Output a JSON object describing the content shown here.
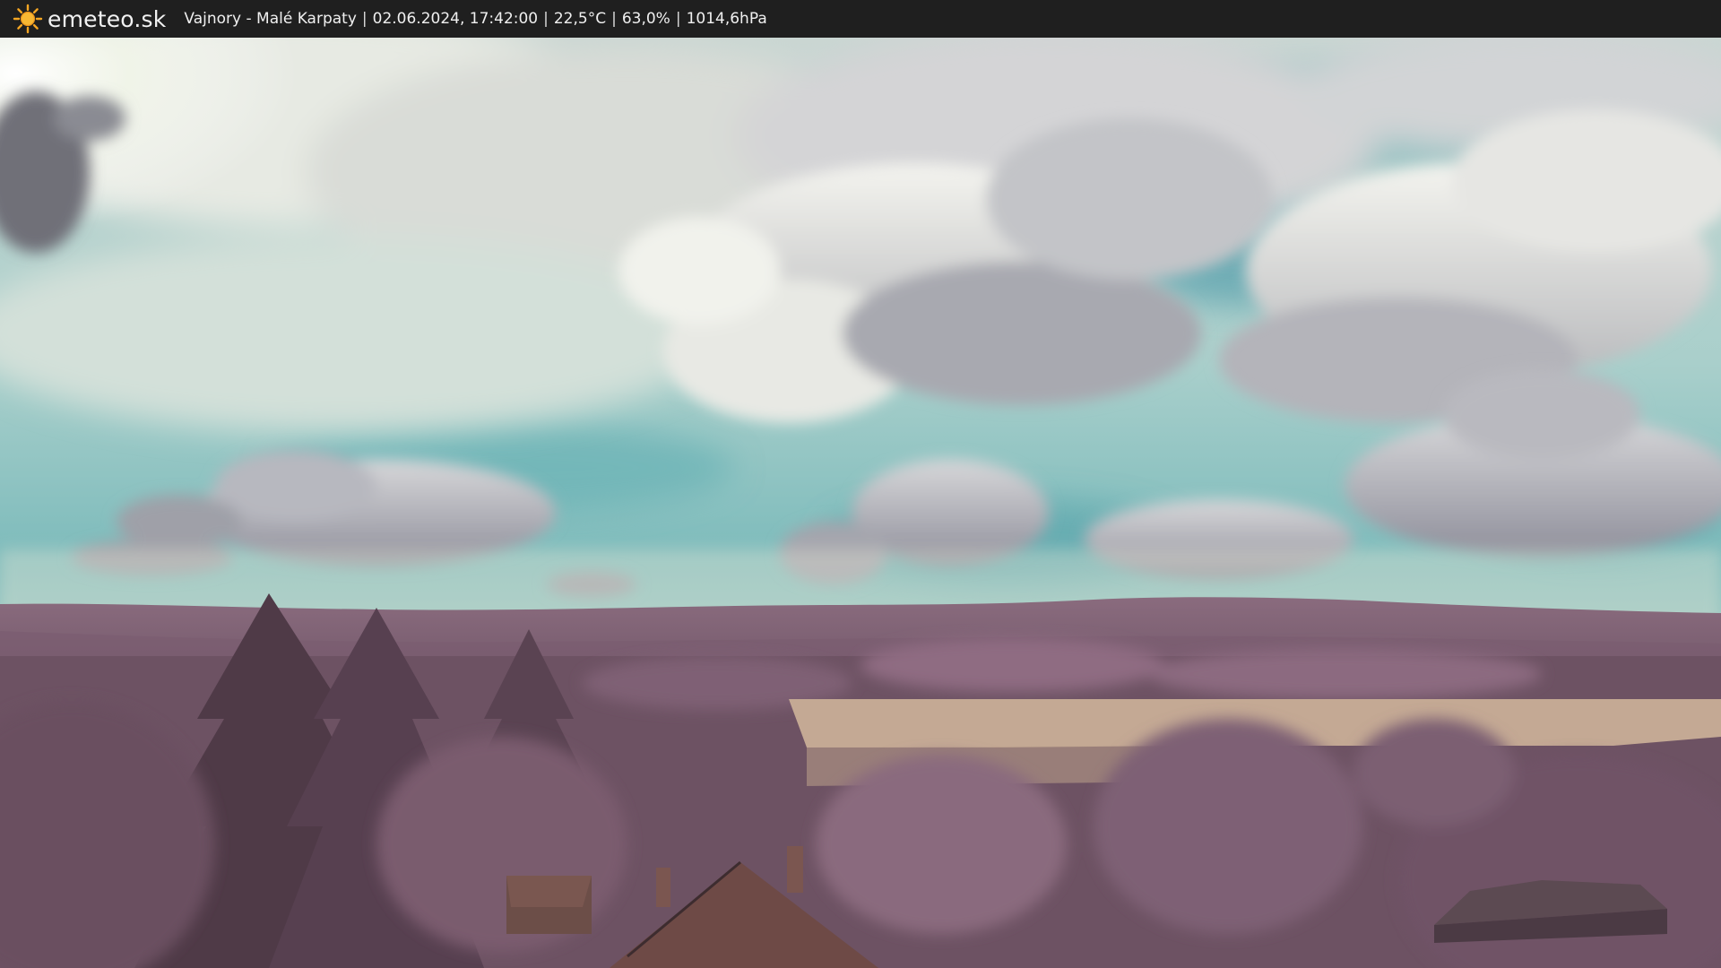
{
  "header": {
    "logo_icon": "sun-icon",
    "brand": "emeteo.sk",
    "location": "Vajnory - Malé Karpaty",
    "datetime": "02.06.2024, 17:42:00",
    "temperature": "22,5°C",
    "humidity": "63,0%",
    "pressure": "1014,6hPa",
    "separator": "|"
  },
  "colors": {
    "bar_bg": "#1f1f1f",
    "sun": "#f5a623",
    "sky_teal": "#6fb4b4",
    "cloud_grey": "#9a9aa6",
    "hills_purple": "#7e5f73",
    "field": "#c9ae96"
  }
}
